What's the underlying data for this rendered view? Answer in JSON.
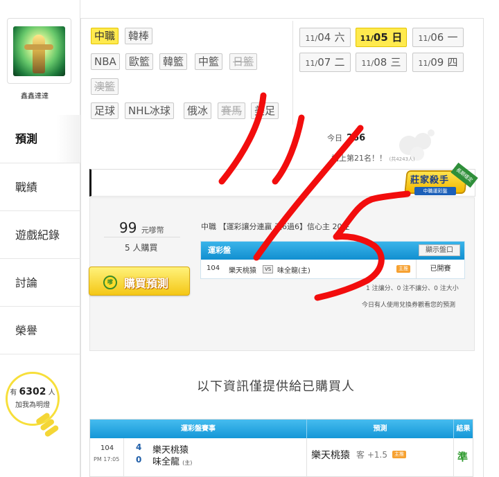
{
  "user": {
    "name": "鑫鑫達達",
    "follow_prefix": "有",
    "follow_count": "6302",
    "follow_unit": "人",
    "follow_suffix": "加我為明燈"
  },
  "sidebar": {
    "items": [
      {
        "label": "預測",
        "active": true
      },
      {
        "label": "戰績",
        "active": false
      },
      {
        "label": "遊戲紀錄",
        "active": false
      },
      {
        "label": "討論",
        "active": false
      },
      {
        "label": "榮譽",
        "active": false
      }
    ]
  },
  "leagues": {
    "row1": [
      "中職",
      "韓棒"
    ],
    "row2": [
      "NBA",
      "歐籃",
      "韓籃",
      "中籃",
      "日籃"
    ],
    "row3": [
      "澳籃"
    ],
    "row4": [
      "足球",
      "NHL冰球",
      "俄冰",
      "賽馬",
      "美足"
    ]
  },
  "dates": [
    {
      "month": "11/",
      "day": "04",
      "weekday": "六"
    },
    {
      "month": "11/",
      "day": "05",
      "weekday": "日"
    },
    {
      "month": "11/",
      "day": "06",
      "weekday": "一"
    },
    {
      "month": "11/",
      "day": "07",
      "weekday": "二"
    },
    {
      "month": "11/",
      "day": "08",
      "weekday": "三"
    },
    {
      "month": "11/",
      "day": "09",
      "weekday": "四"
    }
  ],
  "stats": {
    "today_label": "今日",
    "today_value": "266",
    "rank_text": "站上第21名！！",
    "rank_small": "(共4243人)"
  },
  "badge": {
    "title": "莊家殺手",
    "subtitle": "中職運彩盤",
    "ribbon": "長期穩定"
  },
  "prediction": {
    "price": "99",
    "price_unit": "元嗲幣",
    "buyers": "5 人購買",
    "buy_button": "購買預測",
    "coin": "嗲",
    "title": "中職 【運彩讓分連贏 天6過6】信心主 20注",
    "table_header": "運彩盤",
    "show_button": "顯示盤口",
    "row": {
      "no": "104",
      "team_a": "樂天桃猿",
      "vs": "VS",
      "team_b": "味全龍(主)",
      "badge": "主推",
      "status": "已開賽"
    },
    "summary": "1 注讓分、0 注不讓分、0 注大小",
    "note": "今日有人使用兌換券觀看您的預測"
  },
  "info_title": "以下資訊僅提供給已購買人",
  "results": {
    "headers": [
      "運彩盤賽事",
      "預測",
      "結果"
    ],
    "row": {
      "no": "104",
      "time": "PM 17:05",
      "score_a": "4",
      "score_b": "0",
      "team_a": "樂天桃猿",
      "team_b": "味全龍",
      "team_b_tag": "(主)",
      "pick": "樂天桃猿",
      "pick_side": "客 +1.5",
      "pick_badge": "主推",
      "result": "準"
    }
  },
  "annotation": {
    "handwritten_text": "11/5",
    "color": "#f20d0d"
  },
  "colors": {
    "active_tag": "#ffea4e",
    "header_blue": "#1597d7",
    "result_green": "#2e9a2e"
  }
}
